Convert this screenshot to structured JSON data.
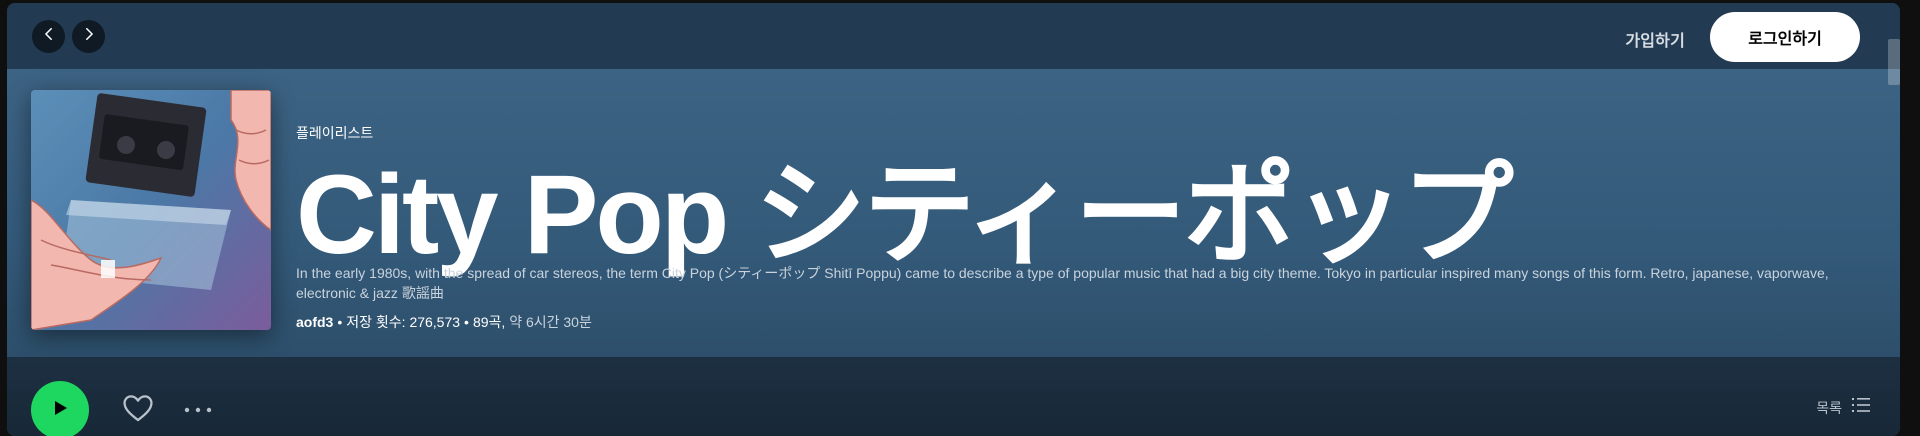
{
  "topbar": {
    "back_icon": "chevron-left-icon",
    "forward_icon": "chevron-right-icon",
    "signup_label": "가입하기",
    "login_label": "로그인하기"
  },
  "playlist": {
    "kind": "플레이리스트",
    "title": "City Pop シティーポップ",
    "description": "In the early 1980s, with the spread of car stereos, the term City Pop (シティーポップ Shitī Poppu) came to describe a type of popular music that had a big city theme. Tokyo in particular inspired many songs of this form. Retro, japanese, vaporwave, electronic & jazz 歌謡曲",
    "owner": "aofd3",
    "saves": "저장 횟수: 276,573",
    "song_count": "89곡,",
    "duration": "약 6시간 30분"
  },
  "actions": {
    "play_icon": "play-icon",
    "like_icon": "heart-icon",
    "more_icon": "more-icon",
    "view_label": "목록",
    "view_icon": "list-icon"
  },
  "colors": {
    "accent": "#1ed760",
    "header": "#3d6384",
    "topbar": "#223b52"
  }
}
